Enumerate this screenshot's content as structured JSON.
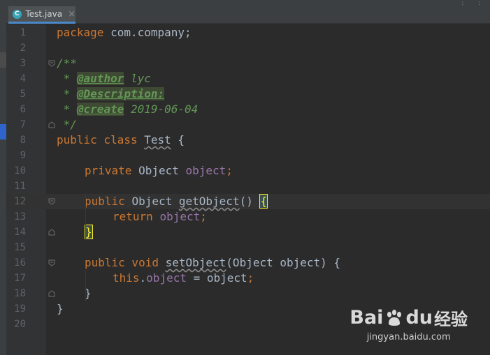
{
  "tab": {
    "filename": "Test.java",
    "icon": "java-class-icon",
    "close": "×"
  },
  "editor": {
    "current_line": 12,
    "lines": [
      {
        "n": "1"
      },
      {
        "n": "2"
      },
      {
        "n": "3"
      },
      {
        "n": "4"
      },
      {
        "n": "5"
      },
      {
        "n": "6"
      },
      {
        "n": "7"
      },
      {
        "n": "8"
      },
      {
        "n": "9"
      },
      {
        "n": "10"
      },
      {
        "n": "11"
      },
      {
        "n": "12"
      },
      {
        "n": "13"
      },
      {
        "n": "14"
      },
      {
        "n": "15"
      },
      {
        "n": "16"
      },
      {
        "n": "17"
      },
      {
        "n": "18"
      },
      {
        "n": "19"
      },
      {
        "n": "20"
      }
    ],
    "code": {
      "l1_kw": "package",
      "l1_rest": " com.company;",
      "l3": "/**",
      "l4_star": " * ",
      "l4_tag": "@author",
      "l4_val": " lyc",
      "l5_star": " * ",
      "l5_tag": "@Description:",
      "l6_star": " * ",
      "l6_tag": "@create",
      "l6_val": " 2019-06-04",
      "l7": " */",
      "l8_kw": "public class ",
      "l8_name": "Test",
      "l8_rest": " {",
      "l10_kw": "private ",
      "l10_type": "Object ",
      "l10_field": "object",
      "l10_semi": ";",
      "l12_kw": "public ",
      "l12_type": "Object ",
      "l12_name": "getObject",
      "l12_paren": "() ",
      "l12_brace": "{",
      "l13_kw": "return ",
      "l13_field": "object",
      "l13_semi": ";",
      "l14_brace": "}",
      "l16_kw": "public void ",
      "l16_name": "setObject",
      "l16_rest": "(Object object) {",
      "l17_kw": "this",
      "l17_dot": ".",
      "l17_field": "object",
      "l17_rest": " = object",
      "l17_semi": ";",
      "l18": "}",
      "l19": "}"
    }
  },
  "watermark": {
    "brand": "Bai",
    "brand2": "du",
    "cn": "经验",
    "url": "jingyan.baidu.com"
  },
  "colors": {
    "keyword": "#cc7832",
    "field": "#9876aa",
    "doc": "#629755",
    "text": "#a9b7c6",
    "background": "#2b2b2b"
  }
}
